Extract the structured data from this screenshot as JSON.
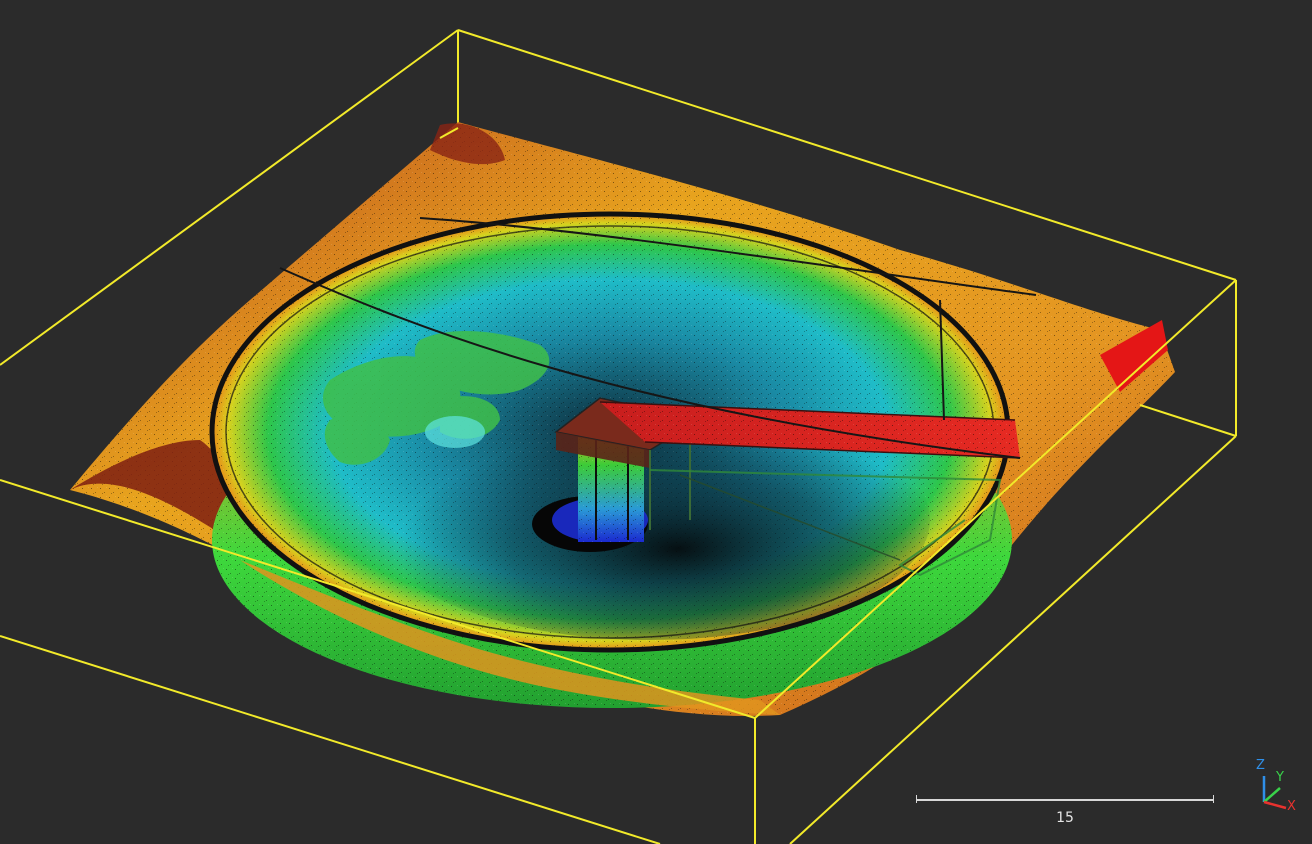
{
  "viewer": {
    "background": "#2b2b2b",
    "bounding_box_color": "#f2ea2a"
  },
  "scale_bar": {
    "label": "15",
    "color": "#d8d8d8"
  },
  "axes": {
    "z_label": "Z",
    "y_label": "Y",
    "x_label": "X",
    "z_color": "#2f8fe8",
    "y_color": "#39d24a",
    "x_color": "#e8322e"
  },
  "point_cloud": {
    "colormap": [
      "#1d2bd6",
      "#1ec6d8",
      "#35c835",
      "#f0c018",
      "#f08a18",
      "#e41e1e",
      "#7a1e10"
    ]
  }
}
